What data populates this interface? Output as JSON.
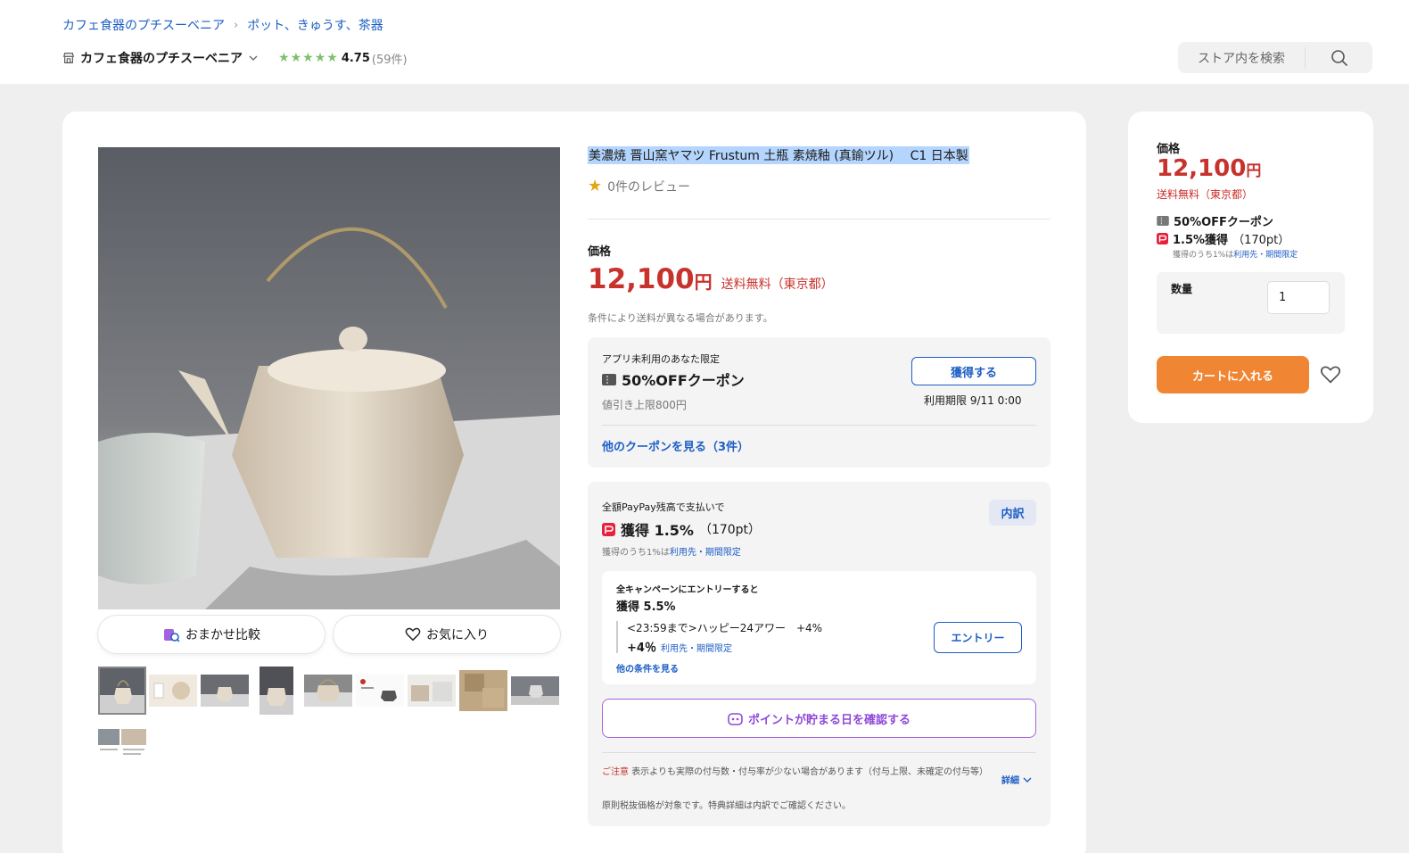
{
  "breadcrumb": {
    "items": [
      "カフェ食器のプチスーベニア",
      "ポット、きゅうす、茶器"
    ],
    "separator": "›"
  },
  "store": {
    "name": "カフェ食器のプチスーベニア",
    "stars": [
      "★",
      "★",
      "★",
      "★",
      "★"
    ],
    "rating": "4.75",
    "review_count": "(59件)"
  },
  "search": {
    "placeholder": "ストア内を検索"
  },
  "product": {
    "title": "美濃焼 晋山窯ヤマツ Frustum 土瓶 素焼釉 (真鍮ツル)　 C1 日本製",
    "reviews_label": "0件のレビュー",
    "compare_label": "おまかせ比較",
    "favorite_label": "お気に入り"
  },
  "price": {
    "label": "価格",
    "amount": "12,100",
    "yen": "円",
    "shipping": "送料無料（東京都）",
    "note": "条件により送料が異なる場合があります。"
  },
  "coupon": {
    "limited": "アプリ未利用のあなた限定",
    "title": "50%OFFクーポン",
    "max": "値引き上限800円",
    "get_button": "獲得する",
    "expires": "利用期限 9/11 0:00",
    "more": "他のクーポンを見る（3件）"
  },
  "paypay": {
    "line1": "全額PayPay残高で支払いで",
    "earn": "獲得 1.5%",
    "points": "（170pt）",
    "note_prefix": "獲得のうち1%は",
    "note_link": "利用先・期間限定",
    "breakdown_button": "内訳",
    "campaign": {
      "title": "全キャンペーンにエントリーすると",
      "earn": "獲得 5.5%",
      "item": "<23:59まで>ハッピー24アワー　+4%",
      "plus": "+4％",
      "link": "利用先・期間限定",
      "more": "他の条件を見る",
      "entry_button": "エントリー"
    },
    "points_day_button": "ポイントが貯まる日を確認する",
    "warning_label": "ご注意",
    "warning_text": "表示よりも実際の付与数・付与率が少ない場合があります（付与上限、未確定の付与等）",
    "details": "詳細",
    "tax_note": "原則税抜価格が対象です。特典詳細は内訳でご確認ください。"
  },
  "side": {
    "price_label": "価格",
    "amount": "12,100",
    "yen": "円",
    "shipping": "送料無料（東京都）",
    "coupon": "50%OFFクーポン",
    "earn": "1.5%獲得",
    "points": "（170pt）",
    "note_prefix": "獲得のうち1%は",
    "note_link": "利用先・期間限定",
    "quantity_label": "数量",
    "quantity_value": "1",
    "cart_button": "カートに入れる"
  },
  "colors": {
    "link": "#1d5ec5",
    "price": "#c8322c",
    "cart": "#f08633",
    "stars": "#7fbf6a"
  }
}
